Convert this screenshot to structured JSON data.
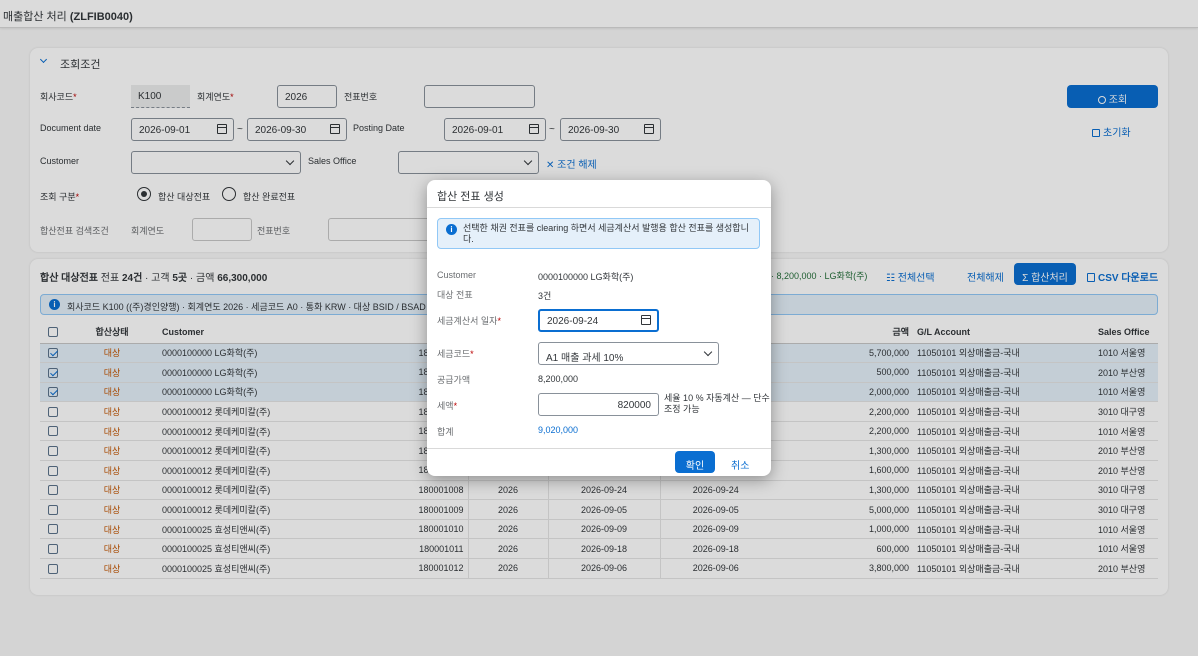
{
  "app": {
    "title_prefix": "매출합산 처리 ",
    "title_code": "(ZLFIB0040)"
  },
  "filter": {
    "header": "조회조건",
    "company_label": "회사코드",
    "company_value": "K100",
    "fiscal_year_label": "회계연도",
    "fiscal_year_value": "2026",
    "doc_no_label": "전표번호",
    "doc_no_value": "",
    "search_button": "조회",
    "doc_date_label": "Document date",
    "doc_date_from": "2026-09-01",
    "doc_date_to": "2026-09-30",
    "posting_date_label": "Posting Date",
    "posting_date_from": "2026-09-01",
    "posting_date_to": "2026-09-30",
    "reset_button": "초기화",
    "customer_label": "Customer",
    "customer_value": "",
    "sales_office_label": "Sales Office",
    "sales_office_value": "",
    "clear_button": "조건 해제",
    "type_label": "조회 구분",
    "type_option1": "합산 대상전표",
    "type_option2": "합산 완료전표",
    "sum_search_label": "합산전표 검색조건",
    "sum_fy_label": "회계연도",
    "sum_doc_label": "전표번호",
    "tilde": "~"
  },
  "results": {
    "title": "합산 대상전표",
    "summary_prefix": "전표 ",
    "summary_doc_count": "24건",
    "summary_mid": " · 고객 ",
    "summary_cust_count": "5곳",
    "summary_mid2": " · 금액 ",
    "summary_amount": "66,300,000",
    "selection_summary": "· 8,200,000 · LG화학(주)",
    "select_all": "전체선택",
    "deselect_all": "전체해제",
    "sum_process": "합산처리",
    "csv_download": "CSV 다운로드",
    "info_text": "회사코드 K100 ((주)경인양행) · 회계연도 2026 · 세금코드 A0 · 통화 KRW · 대상 BSID / BSAD",
    "columns": {
      "status": "합산상태",
      "customer": "Customer",
      "doc_no": "전표번호",
      "amount": "금액",
      "gl": "G/L Account",
      "sales_office": "Sales Office"
    },
    "rows": [
      {
        "sel": true,
        "status": "대상",
        "customer": "0000100000 LG화학(주)",
        "doc": "180001001",
        "fy": "",
        "d1": "",
        "d2": "",
        "amount": "5,700,000",
        "gl": "11050101 외상매출금-국내",
        "office": "1010 서울영"
      },
      {
        "sel": true,
        "status": "대상",
        "customer": "0000100000 LG화학(주)",
        "doc": "180001002",
        "fy": "",
        "d1": "",
        "d2": "",
        "amount": "500,000",
        "gl": "11050101 외상매출금-국내",
        "office": "2010 부산영"
      },
      {
        "sel": true,
        "status": "대상",
        "customer": "0000100000 LG화학(주)",
        "doc": "180001003",
        "fy": "",
        "d1": "",
        "d2": "",
        "amount": "2,000,000",
        "gl": "11050101 외상매출금-국내",
        "office": "1010 서울영"
      },
      {
        "sel": false,
        "status": "대상",
        "customer": "0000100012 롯데케미칼(주)",
        "doc": "180001004",
        "fy": "",
        "d1": "",
        "d2": "",
        "amount": "2,200,000",
        "gl": "11050101 외상매출금-국내",
        "office": "3010 대구영"
      },
      {
        "sel": false,
        "status": "대상",
        "customer": "0000100012 롯데케미칼(주)",
        "doc": "180001005",
        "fy": "",
        "d1": "",
        "d2": "",
        "amount": "2,200,000",
        "gl": "11050101 외상매출금-국내",
        "office": "1010 서울영"
      },
      {
        "sel": false,
        "status": "대상",
        "customer": "0000100012 롯데케미칼(주)",
        "doc": "180001006",
        "fy": "",
        "d1": "",
        "d2": "",
        "amount": "1,300,000",
        "gl": "11050101 외상매출금-국내",
        "office": "2010 부산영"
      },
      {
        "sel": false,
        "status": "대상",
        "customer": "0000100012 롯데케미칼(주)",
        "doc": "180001007",
        "fy": "",
        "d1": "",
        "d2": "",
        "amount": "1,600,000",
        "gl": "11050101 외상매출금-국내",
        "office": "2010 부산영"
      },
      {
        "sel": false,
        "status": "대상",
        "customer": "0000100012 롯데케미칼(주)",
        "doc": "180001008",
        "fy": "2026",
        "d1": "2026-09-24",
        "d2": "2026-09-24",
        "amount": "1,300,000",
        "gl": "11050101 외상매출금-국내",
        "office": "3010 대구영"
      },
      {
        "sel": false,
        "status": "대상",
        "customer": "0000100012 롯데케미칼(주)",
        "doc": "180001009",
        "fy": "2026",
        "d1": "2026-09-05",
        "d2": "2026-09-05",
        "amount": "5,000,000",
        "gl": "11050101 외상매출금-국내",
        "office": "3010 대구영"
      },
      {
        "sel": false,
        "status": "대상",
        "customer": "0000100025 효성티앤씨(주)",
        "doc": "180001010",
        "fy": "2026",
        "d1": "2026-09-09",
        "d2": "2026-09-09",
        "amount": "1,000,000",
        "gl": "11050101 외상매출금-국내",
        "office": "1010 서울영"
      },
      {
        "sel": false,
        "status": "대상",
        "customer": "0000100025 효성티앤씨(주)",
        "doc": "180001011",
        "fy": "2026",
        "d1": "2026-09-18",
        "d2": "2026-09-18",
        "amount": "600,000",
        "gl": "11050101 외상매출금-국내",
        "office": "1010 서울영"
      },
      {
        "sel": false,
        "status": "대상",
        "customer": "0000100025 효성티앤씨(주)",
        "doc": "180001012",
        "fy": "2026",
        "d1": "2026-09-06",
        "d2": "2026-09-06",
        "amount": "3,800,000",
        "gl": "11050101 외상매출금-국내",
        "office": "2010 부산영"
      }
    ]
  },
  "dialog": {
    "title": "합산 전표 생성",
    "info": "선택한 채권 전표를 clearing 하면서 세금계산서 발행용 합산 전표를 생성합니다.",
    "customer_label": "Customer",
    "customer_value": "0000100000 LG화학(주)",
    "docs_label": "대상 전표",
    "docs_value": "3건",
    "invoice_date_label": "세금계산서 일자",
    "invoice_date_value": "2026-09-24",
    "tax_code_label": "세금코드",
    "tax_code_value": "A1 매출 과세 10%",
    "supply_label": "공급가액",
    "supply_value": "8,200,000",
    "tax_label": "세액",
    "tax_value": "820000",
    "tax_note_line1": "세율 10 % 자동계산 — 단수",
    "tax_note_line2": "조정 가능",
    "total_label": "합계",
    "total_value": "9,020,000",
    "ok": "확인",
    "cancel": "취소"
  }
}
